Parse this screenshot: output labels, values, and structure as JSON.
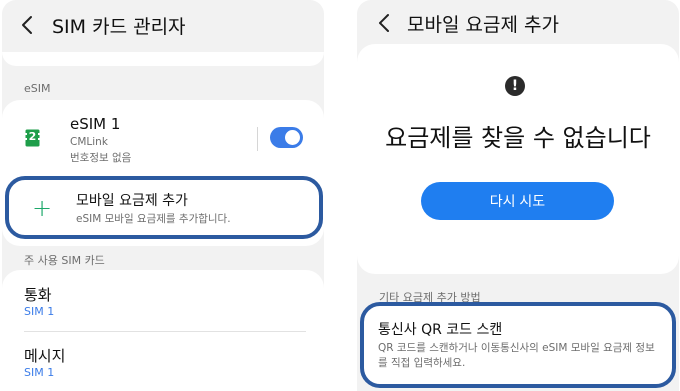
{
  "left": {
    "title": "SIM 카드 관리자",
    "esim_section_label": "eSIM",
    "esim_item": {
      "name": "eSIM 1",
      "carrier": "CMLink",
      "number": "번호정보 없음",
      "chip_number": "2",
      "enabled": true
    },
    "add_plan": {
      "label": "모바일 요금제 추가",
      "description": "eSIM 모바일 요금제를 추가합니다."
    },
    "primary_section_label": "주 사용 SIM 카드",
    "primary_items": [
      {
        "label": "통화",
        "value": "SIM 1"
      },
      {
        "label": "메시지",
        "value": "SIM 1"
      }
    ]
  },
  "right": {
    "title": "모바일 요금제 추가",
    "error_message": "요금제를 찾을 수 없습니다",
    "retry_label": "다시 시도",
    "other_methods_label": "기타 요금제 추가 방법",
    "scan_option": {
      "title": "통신사 QR 코드 스캔",
      "description": "QR 코드를 스캔하거나 이동통신사의 eSIM 모바일 요금제 정보를 직접 입력하세요."
    }
  },
  "colors": {
    "accent": "#3b7ce8",
    "button": "#1f7ef0",
    "highlight": "#2c5aa0",
    "plus": "#1ca86a",
    "chip": "#1e9e4a",
    "background": "#f2f2f2"
  },
  "icons": {
    "back": "chevron-left-icon",
    "sim": "sim-card-icon",
    "add": "plus-icon",
    "alert": "alert-icon"
  }
}
